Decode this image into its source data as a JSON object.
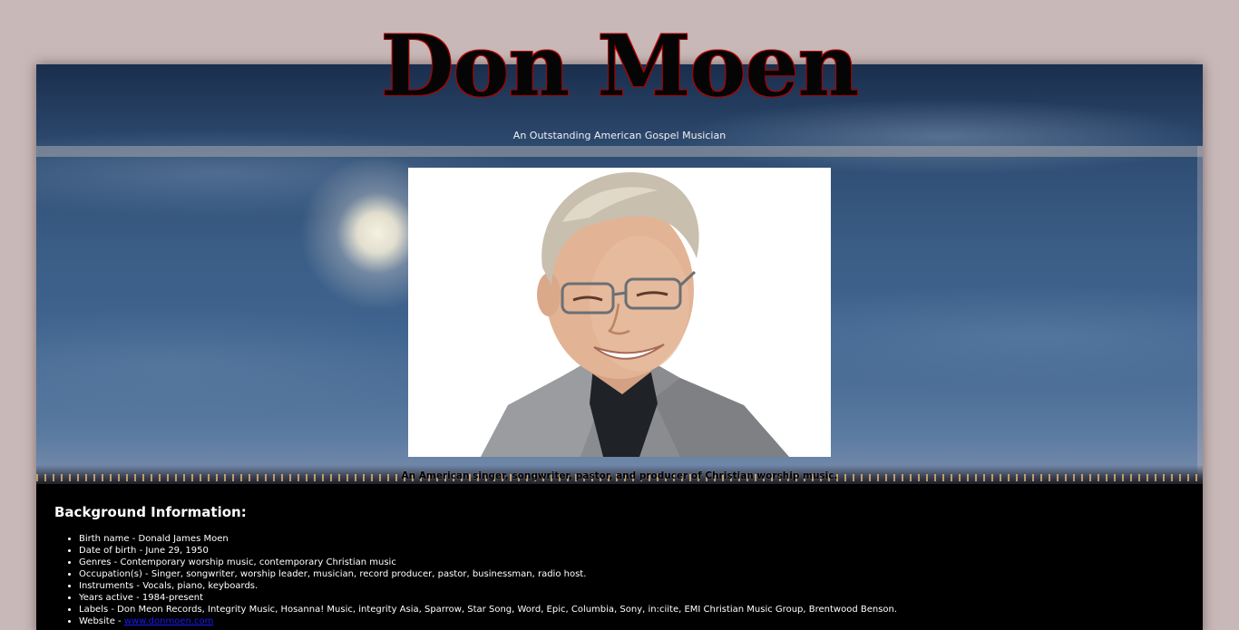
{
  "header": {
    "title": "Don Moen",
    "subtitle": "An Outstanding American Gospel Musician"
  },
  "hero": {
    "caption": "An American singer, songwriter, pastor, and producer of Christian worship music."
  },
  "background": {
    "heading": "Background Information:",
    "items": [
      {
        "label": "Birth name - ",
        "value": "Donald James Moen"
      },
      {
        "label": "Date of birth - ",
        "value": "June 29, 1950"
      },
      {
        "label": "Genres - ",
        "value": "Contemporary worship music, contemporary Christian music"
      },
      {
        "label": "Occupation(s) - ",
        "value": "Singer, songwriter, worship leader, musician, record producer, pastor, businessman, radio host."
      },
      {
        "label": "Instruments - ",
        "value": "Vocals, piano, keyboards."
      },
      {
        "label": "Years active - ",
        "value": "1984-present"
      },
      {
        "label": "Labels - ",
        "value": "Don Meon Records, Integrity Music, Hosanna! Music, integrity Asia, Sparrow, Star Song, Word, Epic, Columbia, Sony, in:ciite, EMI Christian Music Group, Brentwood Benson."
      },
      {
        "label": "Website - ",
        "link": "www.donmoen.com"
      }
    ]
  },
  "colors": {
    "page_bg": "#c8b8b8",
    "title_outline": "#b00000",
    "link": "#1a1aff",
    "bio_bg": "#000000"
  }
}
